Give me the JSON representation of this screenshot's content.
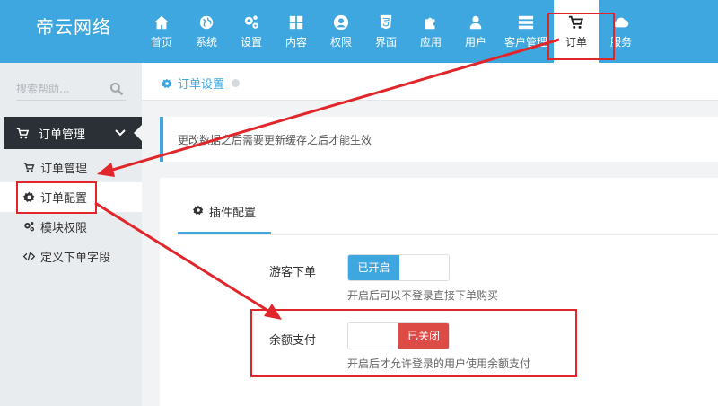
{
  "brand": "帝云网络",
  "nav": [
    {
      "label": "首页",
      "icon": "home-icon"
    },
    {
      "label": "系统",
      "icon": "globe-icon"
    },
    {
      "label": "设置",
      "icon": "cogs-icon"
    },
    {
      "label": "内容",
      "icon": "grid-icon"
    },
    {
      "label": "权限",
      "icon": "user-circle-icon"
    },
    {
      "label": "界面",
      "icon": "html5-icon"
    },
    {
      "label": "应用",
      "icon": "puzzle-icon"
    },
    {
      "label": "用户",
      "icon": "user-icon"
    },
    {
      "label": "客户管理",
      "icon": "server-icon"
    },
    {
      "label": "订单",
      "icon": "cart-icon"
    },
    {
      "label": "服务",
      "icon": "cloud-icon"
    }
  ],
  "sidebar": {
    "search_placeholder": "搜索帮助...",
    "group": "订单管理",
    "items": [
      {
        "label": "订单管理",
        "icon": "cart-icon"
      },
      {
        "label": "订单配置",
        "icon": "gear-icon"
      },
      {
        "label": "模块权限",
        "icon": "cogs-icon"
      },
      {
        "label": "定义下单字段",
        "icon": "code-icon"
      }
    ]
  },
  "breadcrumb": "订单设置",
  "notice": "更改数据之后需要更新缓存之后才能生效",
  "tab": "插件配置",
  "settings": [
    {
      "label": "游客下单",
      "state": "已开启",
      "help": "开启后可以不登录直接下单购买"
    },
    {
      "label": "余额支付",
      "state": "已关闭",
      "help": "开启后才允许登录的用户使用余额支付"
    }
  ],
  "colors": {
    "topbar": "#3fa7e0",
    "on": "#3fa7e0",
    "off": "#dd4b46",
    "annotation": "#e0262b"
  }
}
